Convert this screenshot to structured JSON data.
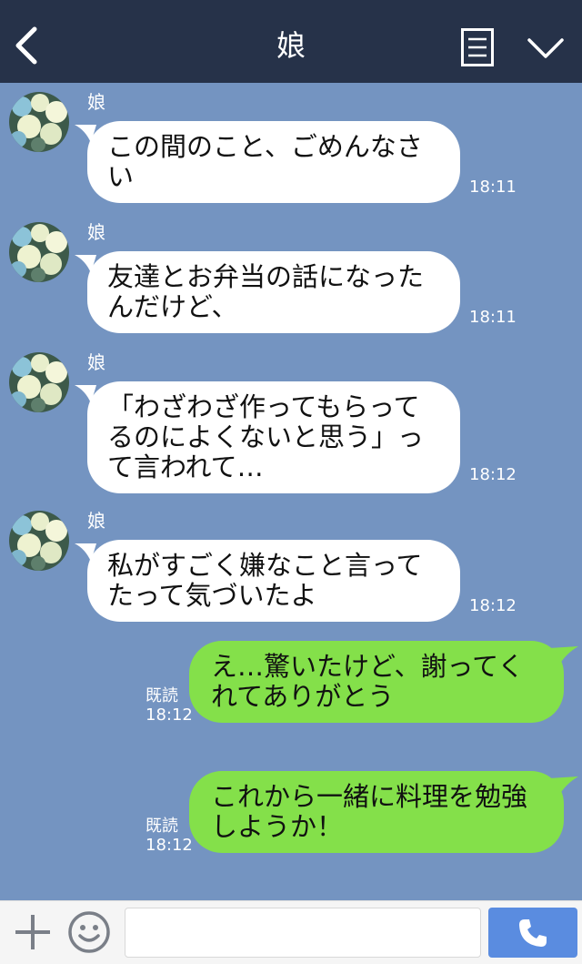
{
  "header": {
    "title": "娘",
    "back_icon": "chevron-left-icon",
    "menu_icon": "list-icon",
    "down_icon": "chevron-down-icon"
  },
  "messages": [
    {
      "sender": "娘",
      "lines": [
        "この間のこと、ごめんなさ",
        "い"
      ],
      "time": "18:11"
    },
    {
      "sender": "娘",
      "lines": [
        "友達とお弁当の話になった",
        "んだけど、"
      ],
      "time": "18:11"
    },
    {
      "sender": "娘",
      "lines": [
        "「わざわざ作ってもらって",
        "るのによくないと思う」っ",
        "て言われて…"
      ],
      "time": "18:12"
    },
    {
      "sender": "娘",
      "lines": [
        "私がすごく嫌なこと言って",
        "たって気づいたよ"
      ],
      "time": "18:12"
    },
    {
      "lines": [
        "え…驚いたけど、謝ってく",
        "れてありがとう"
      ],
      "read": "既読",
      "time": "18:12"
    },
    {
      "lines": [
        "これから一緒に料理を勉強",
        "しようか！"
      ],
      "read": "既読",
      "time": "18:12"
    }
  ],
  "footer": {
    "plus_icon": "plus-icon",
    "emoji_icon": "emoji-icon",
    "input_value": "",
    "call_icon": "phone-icon"
  },
  "colors": {
    "header_bg": "#263249",
    "chat_bg": "#7494c1",
    "incoming_bubble": "#ffffff",
    "outgoing_bubble": "#84e04a",
    "call_button": "#5a8ce0"
  }
}
